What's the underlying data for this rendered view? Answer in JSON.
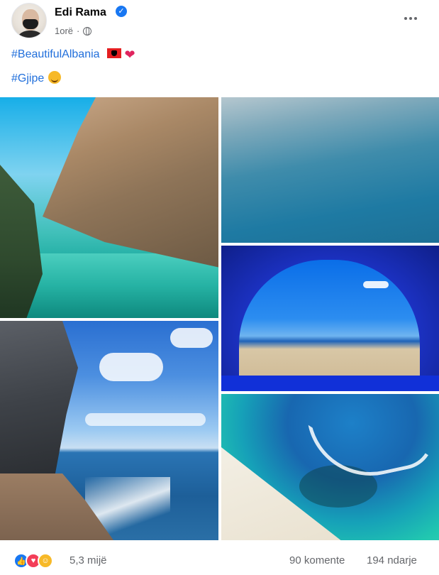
{
  "post": {
    "author": "Edi Rama",
    "verified_badge_icon": "verified-check-icon",
    "time": "1orë",
    "separator": "·",
    "privacy_icon": "globe-icon",
    "more_icon": "more-options-icon"
  },
  "caption": {
    "hashtag1": "#BeautifulAlbania",
    "hashtag1_icons": [
      "albanian-flag-icon",
      "red-heart-icon"
    ],
    "hashtag2": "#Gjipe",
    "hashtag2_icons": [
      "smiling-face-icon"
    ]
  },
  "photos": [
    {
      "name": "canyon-turquoise-water-photo"
    },
    {
      "name": "calm-sea-photo"
    },
    {
      "name": "tent-view-beach-photo"
    },
    {
      "name": "cliff-beach-waves-photo"
    },
    {
      "name": "aerial-beach-boat-photo"
    }
  ],
  "footer": {
    "reactions": [
      "like-icon",
      "love-icon",
      "care-icon"
    ],
    "reaction_count": "5,3 mijë",
    "comments": "90 komente",
    "shares": "194 ndarje"
  },
  "colors": {
    "link_blue": "#216fdb",
    "verified_blue": "#1877f2",
    "secondary_text": "#65676b"
  }
}
